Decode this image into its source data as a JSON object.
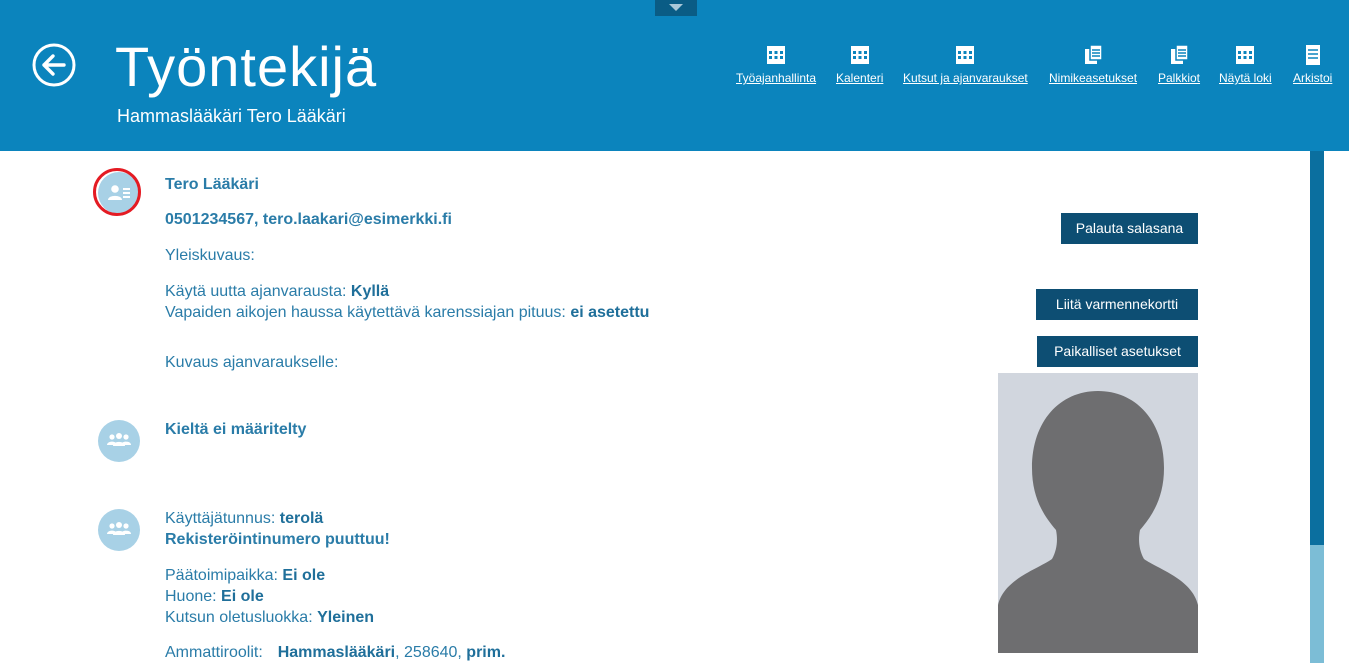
{
  "header": {
    "title": "Työntekijä",
    "subtitle": "Hammaslääkäri Tero Lääkäri",
    "toolbar": [
      {
        "label": "Työajanhallinta",
        "icon": "calendar-icon"
      },
      {
        "label": "Kalenteri",
        "icon": "calendar-icon"
      },
      {
        "label": "Kutsut ja ajanvaraukset",
        "icon": "calendar-icon"
      },
      {
        "label": "Nimikeasetukset",
        "icon": "documents-icon"
      },
      {
        "label": "Palkkiot",
        "icon": "documents-icon"
      },
      {
        "label": "Näytä loki",
        "icon": "calendar-icon"
      },
      {
        "label": "Arkistoi",
        "icon": "document-icon"
      }
    ]
  },
  "profile": {
    "name": "Tero Lääkäri",
    "contact": "0501234567, tero.laakari@esimerkki.fi",
    "general_label": "Yleiskuvaus:",
    "new_booking_label": "Käytä uutta ajanvarausta:",
    "new_booking_value": "Kyllä",
    "grace_label": "Vapaiden aikojen haussa käytettävä karenssiajan pituus:",
    "grace_value": "ei asetettu",
    "booking_desc_label": "Kuvaus ajanvaraukselle:"
  },
  "languages": {
    "text": "Kieltä ei määritelty"
  },
  "account": {
    "username_label": "Käyttäjätunnus:",
    "username_value": "terolä",
    "registration_warning": "Rekisteröintinumero puuttuu!",
    "main_location_label": "Päätoimipaikka:",
    "main_location_value": "Ei ole",
    "room_label": "Huone:",
    "room_value": "Ei ole",
    "call_class_label": "Kutsun oletusluokka:",
    "call_class_value": "Yleinen",
    "roles_label": "Ammattiroolit:",
    "role_name": "Hammaslääkäri",
    "role_code": ", 258640, ",
    "role_type": "prim."
  },
  "actions": {
    "reset_password": "Palauta salasana",
    "attach_card": "Liitä varmennekortti",
    "local_settings": "Paikalliset asetukset"
  },
  "colors": {
    "header_bg": "#0b84bd",
    "button_bg": "#0d4e73",
    "text_blue": "#2a7ca8",
    "highlight_ring": "#e41b23"
  }
}
